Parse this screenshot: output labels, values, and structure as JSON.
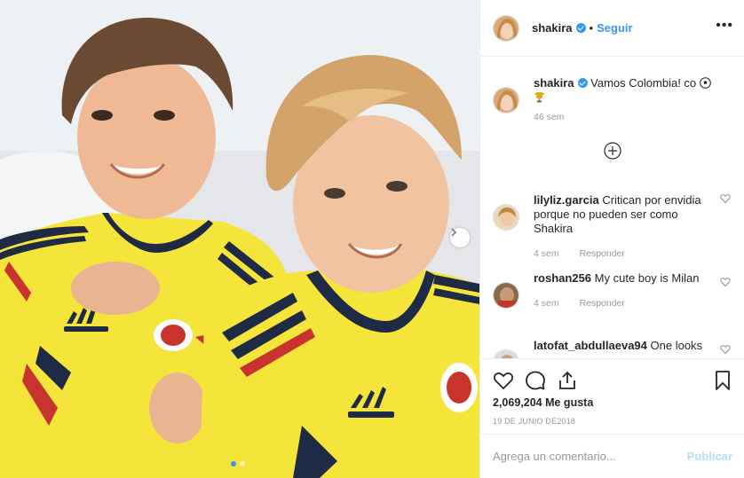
{
  "header": {
    "username": "shakira",
    "follow_label": "Seguir",
    "separator": "•",
    "more_label": "•••"
  },
  "caption": {
    "username": "shakira",
    "text": "Vamos Colombia! co",
    "time": "46 sem"
  },
  "comments": [
    {
      "username": "lilyliz.garcia",
      "text": "Critican por envidia porque no pueden ser como Shakira",
      "time": "4 sem",
      "reply": "Responder"
    },
    {
      "username": "roshan256",
      "text": "My cute boy is Milan",
      "time": "4 sem",
      "reply": "Responder"
    },
    {
      "username": "latofat_abdullaeva94",
      "text": "One looks",
      "time": "",
      "reply": ""
    }
  ],
  "likes": {
    "count": "2,069,204",
    "label": "Me gusta"
  },
  "date": "19 DE JUNIO DE2018",
  "add_comment": {
    "placeholder": "Agrega un comentario...",
    "post_label": "Publicar"
  },
  "carousel": {
    "total": 2,
    "active": 1
  },
  "colors": {
    "accent": "#3897f0",
    "jersey_yellow": "#f5e43a",
    "jersey_navy": "#1f2a44",
    "jersey_red": "#c8332e",
    "post_disabled": "#b2dffc"
  },
  "icons": [
    "heart-icon",
    "comment-icon",
    "share-icon",
    "bookmark-icon",
    "add-circle-icon",
    "chevron-right-icon",
    "verified-icon",
    "more-icon",
    "soccer-ball-icon",
    "trophy-icon"
  ]
}
